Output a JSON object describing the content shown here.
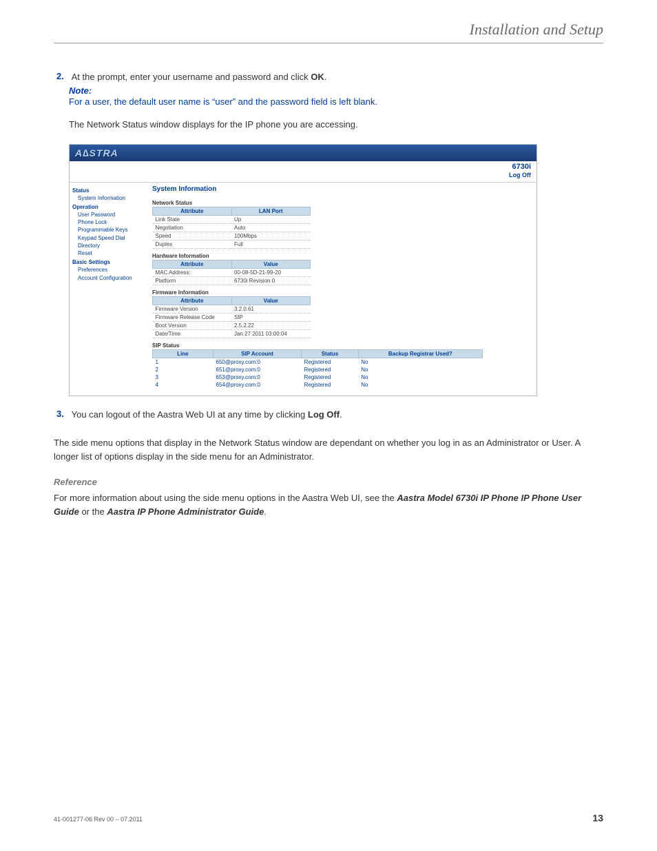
{
  "header": {
    "title": "Installation and Setup"
  },
  "steps": {
    "s2": {
      "num": "2.",
      "text_pre": "At the prompt, enter your username and password and click ",
      "text_bold": "OK",
      "text_post": ".",
      "note_label": "Note:",
      "note_body": "For a user, the default user name is “user” and the password field is left blank.",
      "after": "The Network Status window displays for the IP phone you are accessing."
    },
    "s3": {
      "num": "3.",
      "text_pre": "You can logout of the Aastra Web UI at any time by clicking ",
      "text_bold": "Log Off",
      "text_post": "."
    }
  },
  "main_para": "The side menu options that display in the Network Status window are dependant on whether you log in as an Administrator or User. A longer list of options display in the side menu for an Administrator.",
  "reference": {
    "heading": "Reference",
    "pre": "For more information about using the side menu options in the Aastra Web UI, see the ",
    "b1": "Aastra Model 6730i IP Phone IP Phone User Guide",
    "mid": " or the ",
    "b2": "Aastra IP Phone Administrator Guide",
    "post": "."
  },
  "footer": {
    "left": "41-001277-06 Rev 00 – 07.2011",
    "right": "13"
  },
  "win": {
    "brand": "A∆STRA",
    "model": "6730i",
    "logoff": "Log Off",
    "sidebar": {
      "g1": "Status",
      "g1i": [
        "System Information"
      ],
      "g2": "Operation",
      "g2i": [
        "User Password",
        "Phone Lock",
        "Programmable Keys",
        "Keypad Speed Dial",
        "Directory",
        "Reset"
      ],
      "g3": "Basic Settings",
      "g3i": [
        "Preferences",
        "Account Configuration"
      ]
    },
    "main_title": "System Information",
    "sec1": {
      "h": "Network Status",
      "th1": "Attribute",
      "th2": "LAN Port",
      "rows": [
        [
          "Link State",
          "Up"
        ],
        [
          "Negotiation",
          "Auto"
        ],
        [
          "Speed",
          "100Mbps"
        ],
        [
          "Duplex",
          "Full"
        ]
      ]
    },
    "sec2": {
      "h": "Hardware Information",
      "th1": "Attribute",
      "th2": "Value",
      "rows": [
        [
          "MAC Address:",
          "00-08-5D-21-99-20"
        ],
        [
          "Platform",
          "6730i Revision 0"
        ]
      ]
    },
    "sec3": {
      "h": "Firmware Information",
      "th1": "Attribute",
      "th2": "Value",
      "rows": [
        [
          "Firmware Version",
          "3.2.0.61"
        ],
        [
          "Firmware Release Code",
          "SIP"
        ],
        [
          "Boot Version",
          "2.5.2.22"
        ],
        [
          "Date/Time",
          "Jan 27 2011 03:00:04"
        ]
      ]
    },
    "sec4": {
      "h": "SIP Status",
      "th": [
        "Line",
        "SIP Account",
        "Status",
        "Backup Registrar Used?"
      ],
      "rows": [
        [
          "1",
          "650@proxy.com:0",
          "Registered",
          "No"
        ],
        [
          "2",
          "651@proxy.com:0",
          "Registered",
          "No"
        ],
        [
          "3",
          "653@proxy.com:0",
          "Registered",
          "No"
        ],
        [
          "4",
          "654@proxy.com:0",
          "Registered",
          "No"
        ]
      ]
    }
  }
}
